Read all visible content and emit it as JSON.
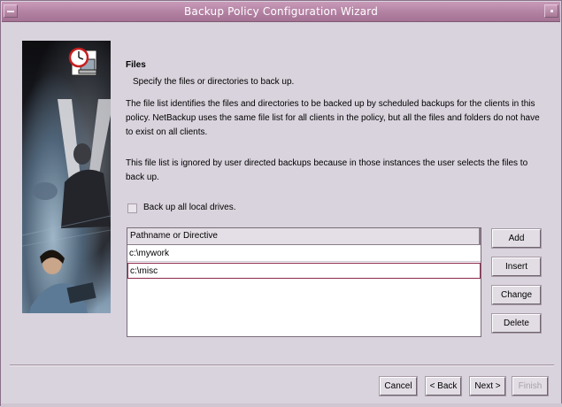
{
  "window": {
    "title": "Backup Policy Configuration Wizard"
  },
  "page": {
    "heading": "Files",
    "subheading": "Specify the files or directories to back up.",
    "para1": "The file list identifies the files and directories to be backed up by scheduled backups for the clients in this policy. NetBackup uses the same file list for all clients in the policy, but all the files and folders do not have to exist on all clients.",
    "para2": "This file list is ignored by user directed backups because in those instances the user selects the files to back up."
  },
  "options": {
    "backup_all_local_drives_label": "Back up all local drives.",
    "backup_all_local_drives_checked": false
  },
  "file_list": {
    "header": "Pathname or Directive",
    "rows": [
      "c:\\mywork",
      "c:\\misc"
    ],
    "selected_index": 1
  },
  "list_buttons": {
    "add": "Add",
    "insert": "Insert",
    "change": "Change",
    "delete": "Delete"
  },
  "footer_buttons": {
    "cancel": "Cancel",
    "back": "< Back",
    "next": "Next >",
    "finish": "Finish",
    "finish_enabled": false
  },
  "colors": {
    "titlebar": "#b07fa0",
    "window_bg": "#d9d3dd",
    "selection_border": "#8c2a4a"
  }
}
